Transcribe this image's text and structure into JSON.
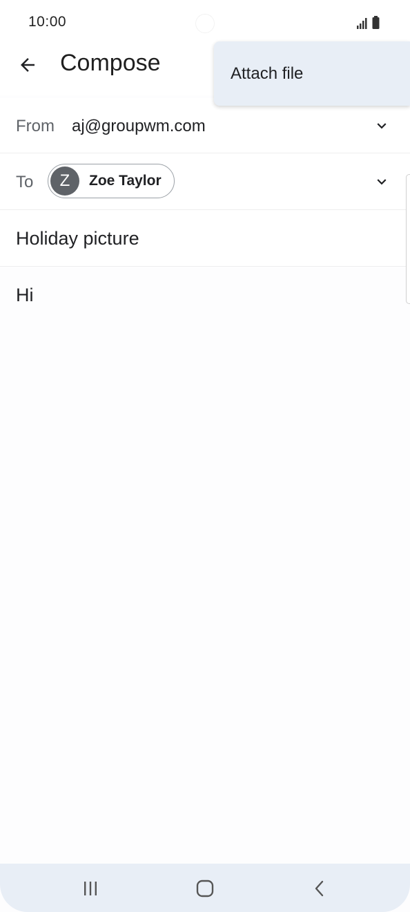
{
  "status_bar": {
    "time": "10:00"
  },
  "app_bar": {
    "title": "Compose",
    "back_icon": "arrow-left-icon"
  },
  "menu": {
    "items": [
      {
        "label": "Attach file"
      }
    ]
  },
  "from_field": {
    "label": "From",
    "value": "aj@groupwm.com"
  },
  "to_field": {
    "label": "To",
    "recipient": {
      "initial": "Z",
      "name": "Zoe Taylor"
    }
  },
  "subject": {
    "value": "Holiday picture"
  },
  "body": {
    "value": "Hi"
  },
  "nav_bar": {
    "icons": [
      "recents-icon",
      "home-icon",
      "back-icon"
    ]
  },
  "colors": {
    "menu_background": "#e8eef6",
    "avatar": "#5f6368",
    "nav_background": "#e8eef6"
  }
}
